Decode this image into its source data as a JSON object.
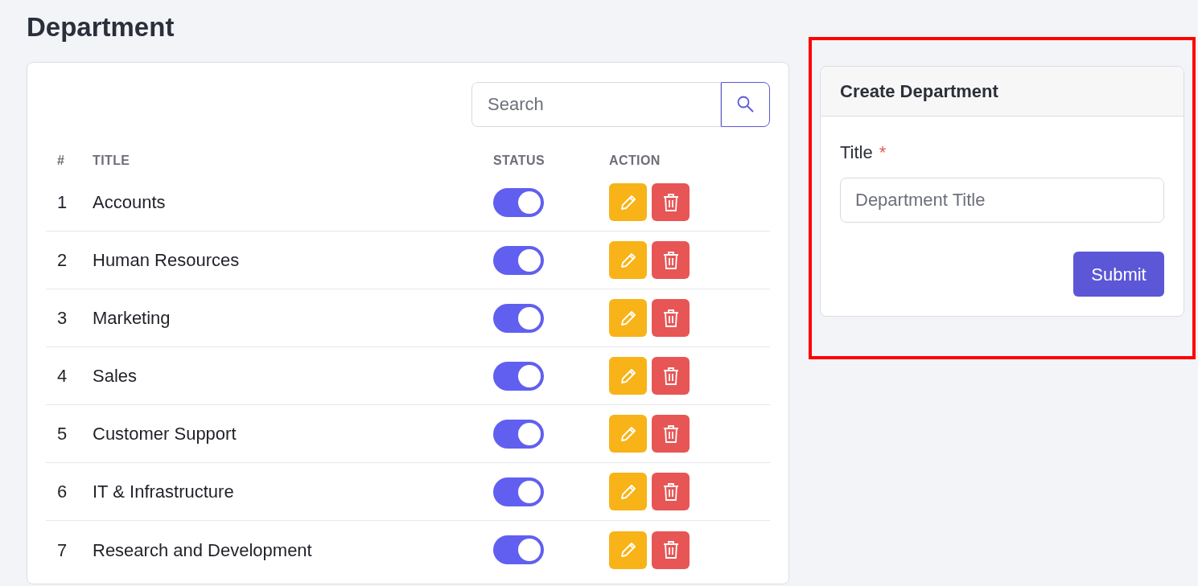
{
  "page_title": "Department",
  "search": {
    "placeholder": "Search"
  },
  "table": {
    "columns": [
      "#",
      "TITLE",
      "STATUS",
      "ACTION"
    ],
    "rows": [
      {
        "number": "1",
        "title": "Accounts",
        "on": true
      },
      {
        "number": "2",
        "title": "Human Resources",
        "on": true
      },
      {
        "number": "3",
        "title": "Marketing",
        "on": true
      },
      {
        "number": "4",
        "title": "Sales",
        "on": true
      },
      {
        "number": "5",
        "title": "Customer Support",
        "on": true
      },
      {
        "number": "6",
        "title": "IT & Infrastructure",
        "on": true
      },
      {
        "number": "7",
        "title": "Research and Development",
        "on": true
      }
    ]
  },
  "form": {
    "heading": "Create Department",
    "field_label": "Title",
    "required_mark": "*",
    "placeholder": "Department Title",
    "submit": "Submit"
  }
}
